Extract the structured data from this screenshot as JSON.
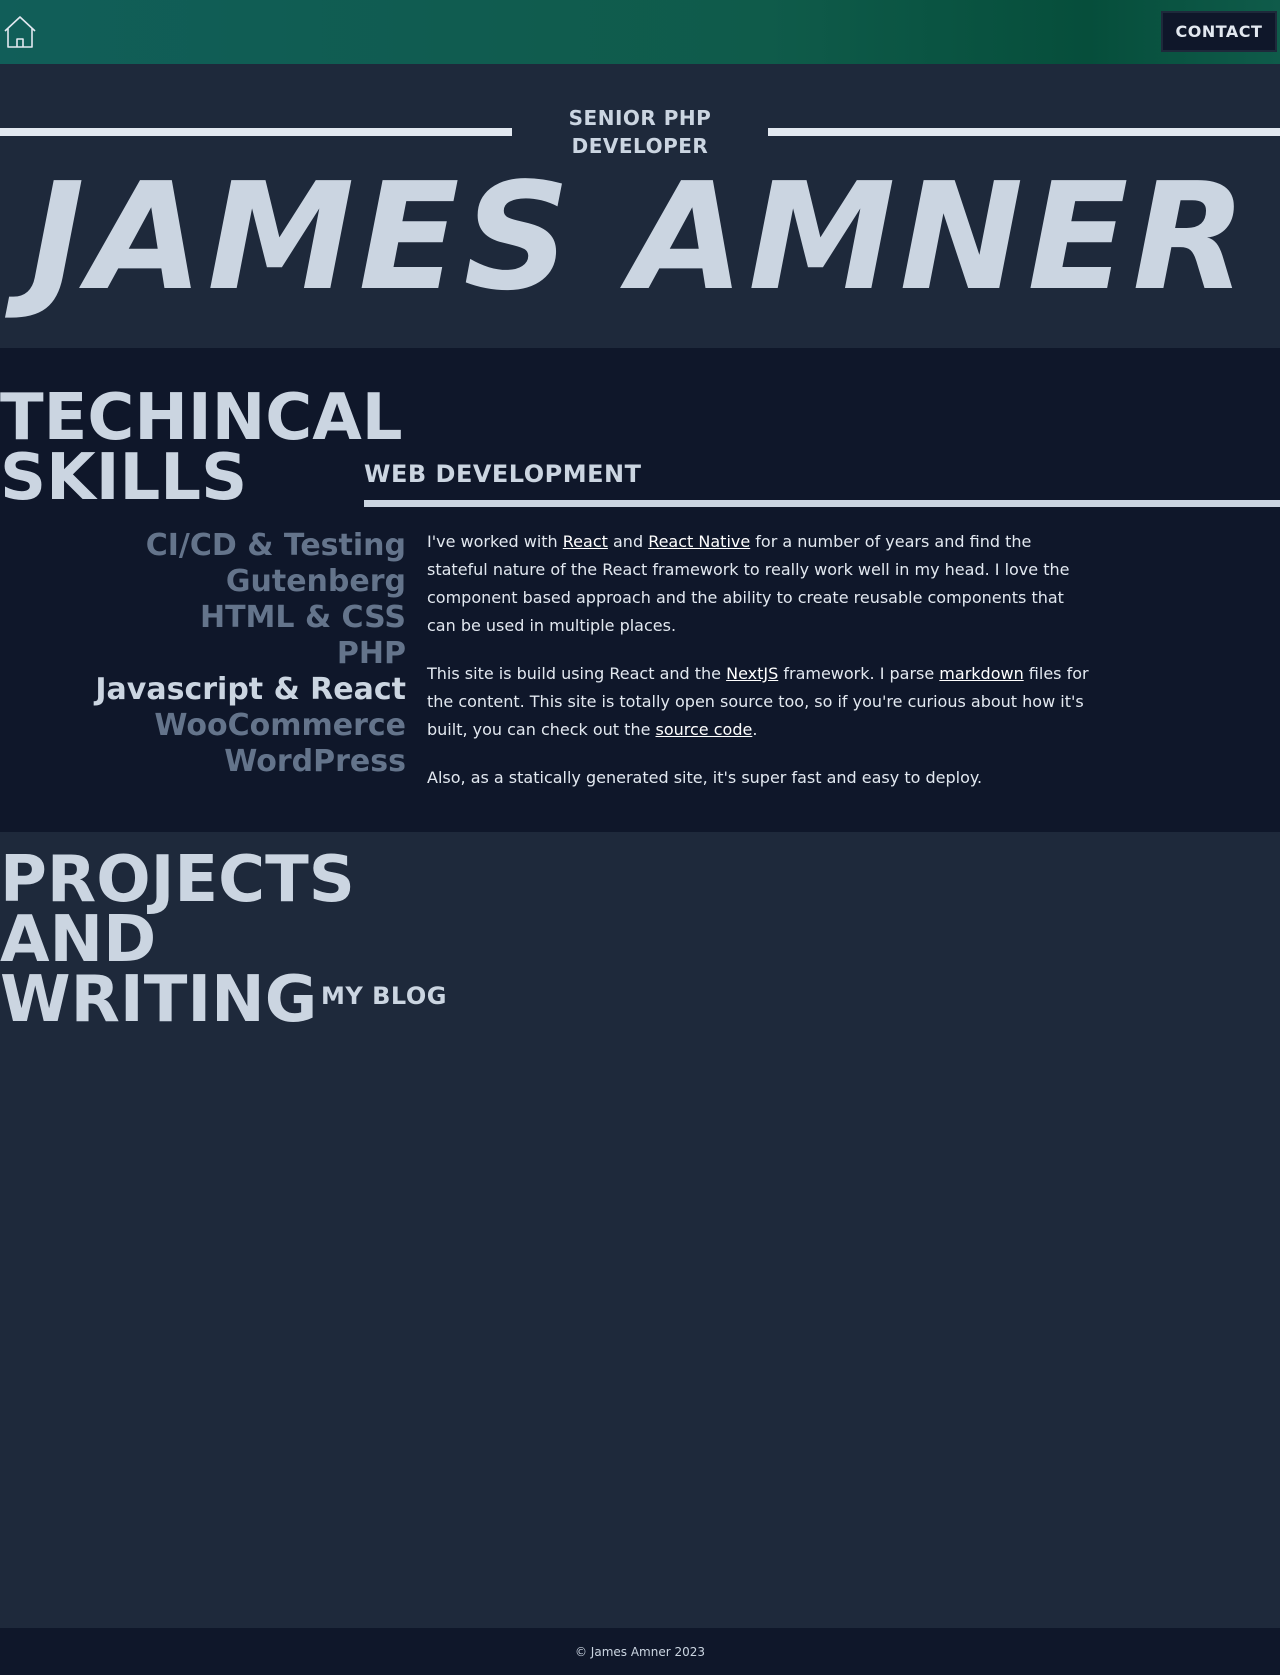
{
  "header": {
    "contact_label": "CONTACT",
    "home_icon": "home-icon"
  },
  "hero": {
    "subtitle_line1": "SENIOR PHP",
    "subtitle_line2": "DEVELOPER",
    "name": "JAMES AMNER"
  },
  "skills": {
    "title_line1": "TECHINCAL",
    "title_line2": "SKILLS",
    "items": [
      "CI/CD & Testing",
      "Gutenberg",
      "HTML & CSS",
      "PHP",
      "Javascript & React",
      "WooCommerce",
      "WordPress"
    ],
    "active_item": "Javascript & React",
    "section_title": "WEB DEVELOPMENT",
    "p1": {
      "t1": "I've worked with ",
      "link1": "React",
      "t2": " and ",
      "link2": "React Native",
      "t3": " for a number of years and find the stateful nature of the React framework to really work well in my head. I love the component based approach and the ability to create reusable components that can be used in multiple places."
    },
    "p2": {
      "t1": "This site is build using React and the ",
      "link1": "NextJS",
      "t2": " framework. I parse ",
      "link2": "markdown",
      "t3": " files for the content. This site is totally open source too, so if you're curious about how it's built, you can check out the ",
      "link3": "source code",
      "t4": "."
    },
    "p3": "Also, as a statically generated site, it's super fast and easy to deploy."
  },
  "projects": {
    "title_line1": "PROJECTS",
    "title_line2": "AND",
    "title_line3": "WRITING",
    "blog_title": "MY BLOG"
  },
  "footer": {
    "copyright": "© James Amner 2023"
  },
  "colors": {
    "accent_teal": "#115e59",
    "bg_dark": "#0f172a",
    "bg_slate": "#1e293b",
    "text": "#cbd5e1",
    "muted": "#64748b"
  }
}
